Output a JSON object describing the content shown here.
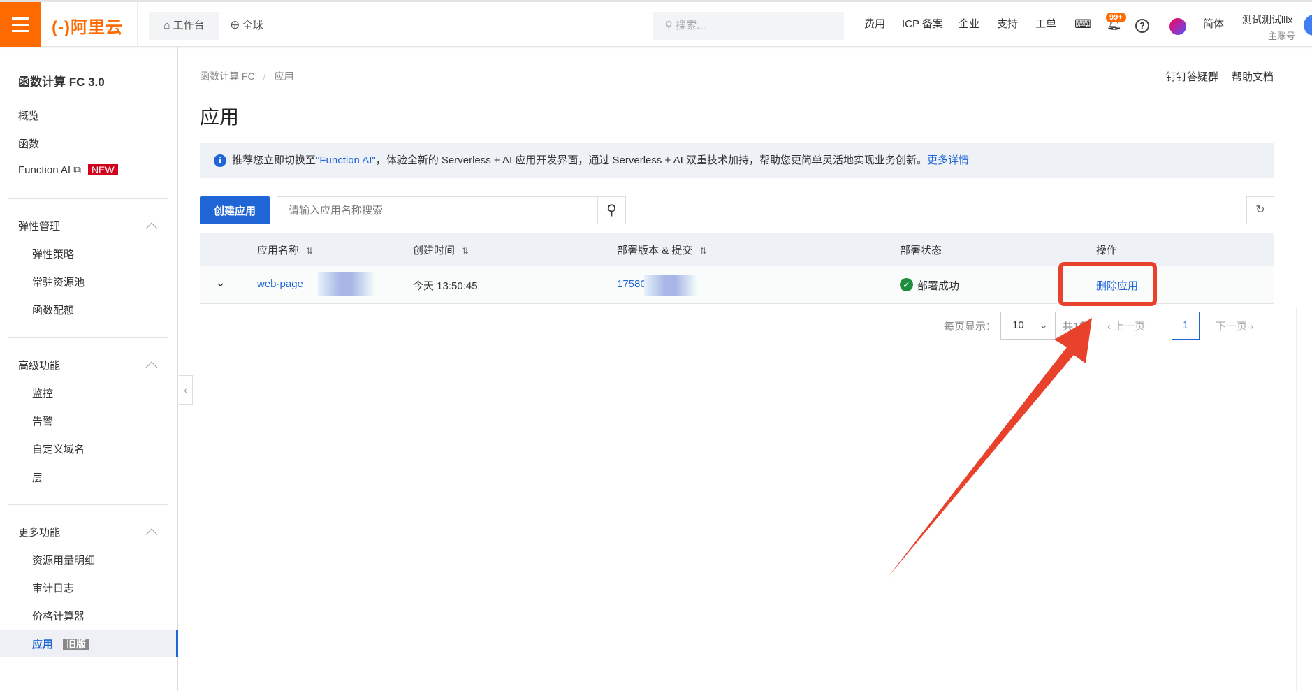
{
  "topbar": {
    "logo": "(-)阿里云",
    "workbench": "工作台",
    "region": "全球",
    "search_placeholder": "搜索...",
    "nav": [
      "费用",
      "ICP 备案",
      "企业",
      "支持",
      "工单"
    ],
    "notification_badge": "99+",
    "language": "简体",
    "user_name": "测试测试lllx",
    "account_type": "主账号"
  },
  "sidebar": {
    "title": "函数计算 FC 3.0",
    "items": [
      "概览",
      "函数",
      "Function AI"
    ],
    "new_tag": "NEW",
    "groups": [
      {
        "label": "弹性管理",
        "items": [
          "弹性策略",
          "常驻资源池",
          "函数配额"
        ]
      },
      {
        "label": "高级功能",
        "items": [
          "监控",
          "告警",
          "自定义域名",
          "层"
        ]
      },
      {
        "label": "更多功能",
        "items": [
          "资源用量明细",
          "审计日志",
          "价格计算器",
          "应用"
        ]
      }
    ],
    "old_tag": "旧版"
  },
  "main": {
    "breadcrumb": [
      "函数计算 FC",
      "应用"
    ],
    "title": "应用",
    "help_links": [
      "钉钉答疑群",
      "帮助文档"
    ],
    "notice": {
      "pre": "推荐您立即切换至",
      "link": "\"Function AI\"",
      "post": "，体验全新的 Serverless + AI 应用开发界面，通过 Serverless + AI 双重技术加持，帮助您更简单灵活地实现业务创新。",
      "more": "更多详情"
    },
    "create_button": "创建应用",
    "search_placeholder": "请输入应用名称搜索",
    "table": {
      "columns": [
        "应用名称",
        "创建时间",
        "部署版本 & 提交",
        "部署状态",
        "操作"
      ],
      "rows": [
        {
          "name": "web-page",
          "created": "今天 13:50:45",
          "version": "17580",
          "status": "部署成功",
          "action": "删除应用"
        }
      ]
    },
    "pagination": {
      "per_page_label": "每页显示：",
      "per_page": "10",
      "total": "共1条",
      "prev": "上一页",
      "page": "1",
      "next": "下一页"
    }
  },
  "colors": {
    "brand": "#ff6a00",
    "primary": "#1f65d6",
    "annotation": "#e8412c"
  }
}
